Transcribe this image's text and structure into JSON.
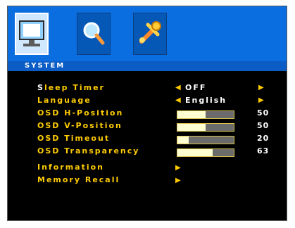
{
  "tabs": [
    {
      "name": "monitor-icon",
      "active": true
    },
    {
      "name": "magnifier-icon",
      "active": false
    },
    {
      "name": "tools-icon",
      "active": false
    }
  ],
  "section_title": "SYSTEM",
  "menu": {
    "items": [
      {
        "label_first": "S",
        "label_rest": "leep Timer",
        "type": "select",
        "value": "OFF"
      },
      {
        "label": "Language",
        "type": "select",
        "value": "English"
      },
      {
        "label": "OSD H-Position",
        "type": "slider",
        "value": 50,
        "max": 100,
        "number": "50"
      },
      {
        "label": "OSD V-Position",
        "type": "slider",
        "value": 50,
        "max": 100,
        "number": "50"
      },
      {
        "label": "OSD Timeout",
        "type": "slider",
        "value": 20,
        "max": 100,
        "number": "20"
      },
      {
        "label": "OSD Transparency",
        "type": "slider",
        "value": 63,
        "max": 100,
        "number": "63"
      },
      {
        "label": "Information",
        "type": "submenu"
      },
      {
        "label": "Memory Recall",
        "type": "submenu"
      }
    ]
  },
  "icons": {
    "left_arrow": "◀",
    "right_arrow": "▶"
  },
  "colors": {
    "topbar_blue": "#0a6ee0",
    "label_yellow": "#ffcc00",
    "background": "#000000"
  }
}
